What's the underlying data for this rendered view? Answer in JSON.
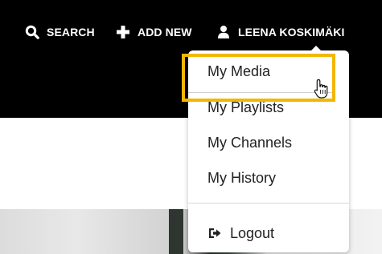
{
  "header": {
    "search_label": "SEARCH",
    "add_new_label": "ADD NEW",
    "user_name": "LEENA KOSKIMÄKI"
  },
  "user_menu": {
    "items": [
      {
        "label": "My Media"
      },
      {
        "label": "My Playlists"
      },
      {
        "label": "My Channels"
      },
      {
        "label": "My History"
      }
    ],
    "logout_label": "Logout"
  },
  "colors": {
    "header_bg": "#000000",
    "highlight": "#f2b705"
  },
  "icons": {
    "search": "search-icon",
    "add": "plus-icon",
    "user": "user-icon",
    "logout": "logout-icon",
    "cursor": "hand-cursor-icon"
  }
}
